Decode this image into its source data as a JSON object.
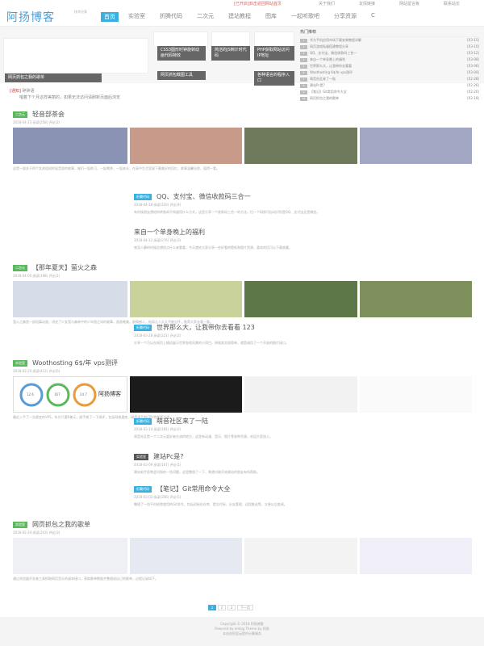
{
  "top": {
    "promo": "[已开启]双击返回网站首页",
    "links": [
      "关于我们",
      "友情链接",
      "网站留言板",
      "联系站长"
    ]
  },
  "header": {
    "logo": "阿扬博客",
    "sub": "技术分享"
  },
  "nav": [
    "首页",
    "实验室",
    "折腾代码",
    "二次元",
    "建站教程",
    "图库",
    "一起听歌吧",
    "分享资源",
    "C"
  ],
  "banner": {
    "cards": [
      "CSS3圆形时钟旋转动画代码特效",
      "简洁的JS倒计时代码",
      "PHP获取网站访问IP地址",
      "网页抓包之我的歌单",
      "网页抓包截图工具",
      "各种语言的程序入口"
    ]
  },
  "hot": {
    "title": "热门推荐",
    "items": [
      {
        "n": "1",
        "t": "华为手机应用市场下载安装教程详解",
        "d": "[03-15]"
      },
      {
        "n": "2",
        "t": "网页游戏私服搭建教程分享",
        "d": "[03-10]"
      },
      {
        "n": "3",
        "t": "QQ、支付宝、微信收款码三合一",
        "d": "[03-12]"
      },
      {
        "n": "4",
        "t": "来自一个单身晚上的福利",
        "d": "[03-08]"
      },
      {
        "n": "5",
        "t": "世界那么大，让我带你去看看",
        "d": "[03-06]"
      },
      {
        "n": "6",
        "t": "Woothosting 6$/年 vps测评",
        "d": "[03-04]"
      },
      {
        "n": "7",
        "t": "萌音社区来了一陆",
        "d": "[02-28]"
      },
      {
        "n": "8",
        "t": "建站Pc是?",
        "d": "[02-26]"
      },
      {
        "n": "9",
        "t": "【笔记】Git常用命令大全",
        "d": "[02-20]"
      },
      {
        "n": "10",
        "t": "网页抓包之我的歌单",
        "d": "[02-18]"
      }
    ]
  },
  "notice": {
    "label": "[通知]",
    "title": "碎碎语",
    "text": "唱着下个月这样美丽的，如果无法访问请刷新页面后浏览"
  },
  "posts": [
    {
      "tag": "二次元",
      "title": "轻音部茶会",
      "meta": "2018-04-23  阅读(258)  评论(2)",
      "excerpt": "这是一部关于四个女孩组成的轻音部的故事，她们一起练习，一起喝茶，一起成长，在高中生活里留下最美好的回忆，故事温馨治愈，值得一看。"
    },
    {
      "tag": "折腾代码",
      "title": "QQ、支付宝、微信收款码三合一",
      "meta": "2018-04-18  阅读(310)  评论(4)",
      "excerpt": "有时候朋友想给你转账却不知道用什么方式，这里分享一个收款码三合一的方法，扫一个码即可自动识别是QQ、支付宝还是微信。"
    },
    {
      "tag": "",
      "title": "来自一个单身晚上的福利",
      "meta": "2018-04-12  阅读(276)  评论(3)",
      "excerpt": "夜深人静的时候总想找点什么来看看，今天就给大家分享一些好看的壁纸和图片资源，喜欢的话可以下载收藏。"
    },
    {
      "tag": "二次元",
      "title": "【那年夏天】萤火之森",
      "meta": "2018-04-05  阅读(198)  评论(1)",
      "excerpt": "萤火之森是一部短篇动画，讲述了少女萤与森林中的少年银之间的故事，画面唯美，剧情感人，结局让人久久不能忘怀，推荐大家去看一看。"
    },
    {
      "tag": "折腾代码",
      "title": "世界那么大，让我带你去看看 123",
      "meta": "2018-03-28  阅读(221)  评论(2)",
      "excerpt": "分享一个可以在网页上随机展示世界各地风景的小项目，原理其实很简单，就是调用了一个开放的图片接口。"
    },
    {
      "tag": "实验室",
      "title": "Woothosting 6$/年 vps测评",
      "meta": "2018-03-20  阅读(412)  评论(6)",
      "excerpt": "最近入手了一台便宜的VPS，年付只要6美元，顺手做了一下测评，包括网络速度、磁盘读写和CPU性能等方面。"
    },
    {
      "tag": "折腾代码",
      "title": "萌音社区来了一陆",
      "meta": "2018-03-14  阅读(185)  评论(2)",
      "excerpt": "萌音社区是一个二次元爱好者交流的地方，这里有动漫、音乐、图片等各种资源，欢迎大家加入。"
    },
    {
      "tag": "实验室",
      "title": "建站Pc是?",
      "meta": "2018-03-09  阅读(167)  评论(1)",
      "excerpt": "建站新手经常会问到的一些问题，这里整理了一下，希望对刚开始建站的朋友有所帮助。"
    },
    {
      "tag": "折腾代码",
      "title": "【笔记】Git常用命令大全",
      "meta": "2018-03-02  阅读(356)  评论(5)",
      "excerpt": "整理了一些平时经常使用的Git命令，包括初始化仓库、提交代码、分支管理、远程推送等，方便以后查阅。"
    },
    {
      "tag": "实验室",
      "title": "网页抓包之我的歌单",
      "meta": "2018-02-24  阅读(243)  评论(3)",
      "excerpt": "通过浏览器开发者工具抓取网页音乐的请求接口，获取歌单数据并整理成自己的歌单，过程记录如下。"
    }
  ],
  "speed": {
    "a": "12.6",
    "b": "167",
    "c": "24.7",
    "label": "阿扬博客"
  },
  "pager": [
    "1",
    "2",
    "3",
    "下一页"
  ],
  "footer": [
    "Copyright © 2018 阿扬博客",
    "Powered by emlog  Theme by 阿扬",
    "本站由阿里云提供计算服务"
  ]
}
